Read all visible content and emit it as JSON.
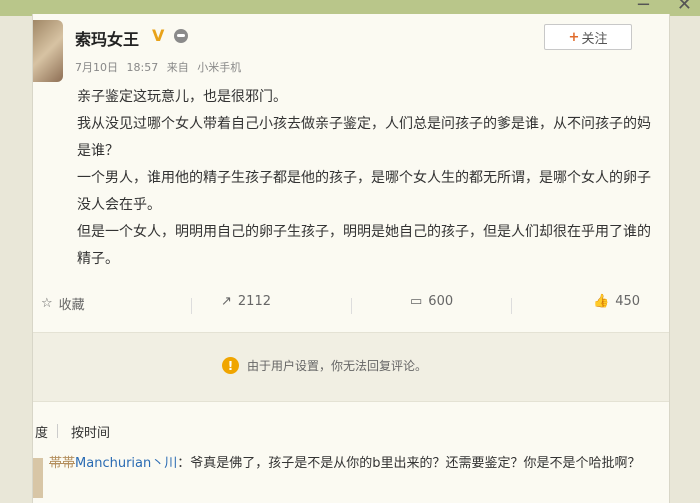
{
  "window": {
    "controls": [
      "−",
      "✕"
    ]
  },
  "post": {
    "username": "索玛女王",
    "verified_mark": "V",
    "follow_label": "关注",
    "meta": {
      "date": "7月10日",
      "time": "18:57",
      "source_prefix": "来自",
      "source": "小米手机"
    },
    "paragraphs": [
      "亲子鉴定这玩意儿，也是很邪门。",
      "我从没见过哪个女人带着自己小孩去做亲子鉴定，人们总是问孩子的爹是谁，从不问孩子的妈是谁？",
      "一个男人，谁用他的精子生孩子都是他的孩子，是哪个女人生的都无所谓，是哪个女人的卵子没人会在乎。",
      "但是一个女人，明明用自己的卵子生孩子，明明是她自己的孩子，但是人们却很在乎用了谁的精子。"
    ]
  },
  "actions": {
    "favorite": "收藏",
    "repost": "2112",
    "comment": "600",
    "like": "450"
  },
  "notice": {
    "text": "由于用户设置，你无法回复评论。"
  },
  "sort": {
    "hot": "度",
    "by_time": "按时间"
  },
  "comment": {
    "faded_name": "帯帯",
    "user": "Manchurian丶川",
    "text": "：爷真是佛了，孩子是不是从你的b里出来的？还需要鉴定？你是不是个哈批啊？"
  }
}
